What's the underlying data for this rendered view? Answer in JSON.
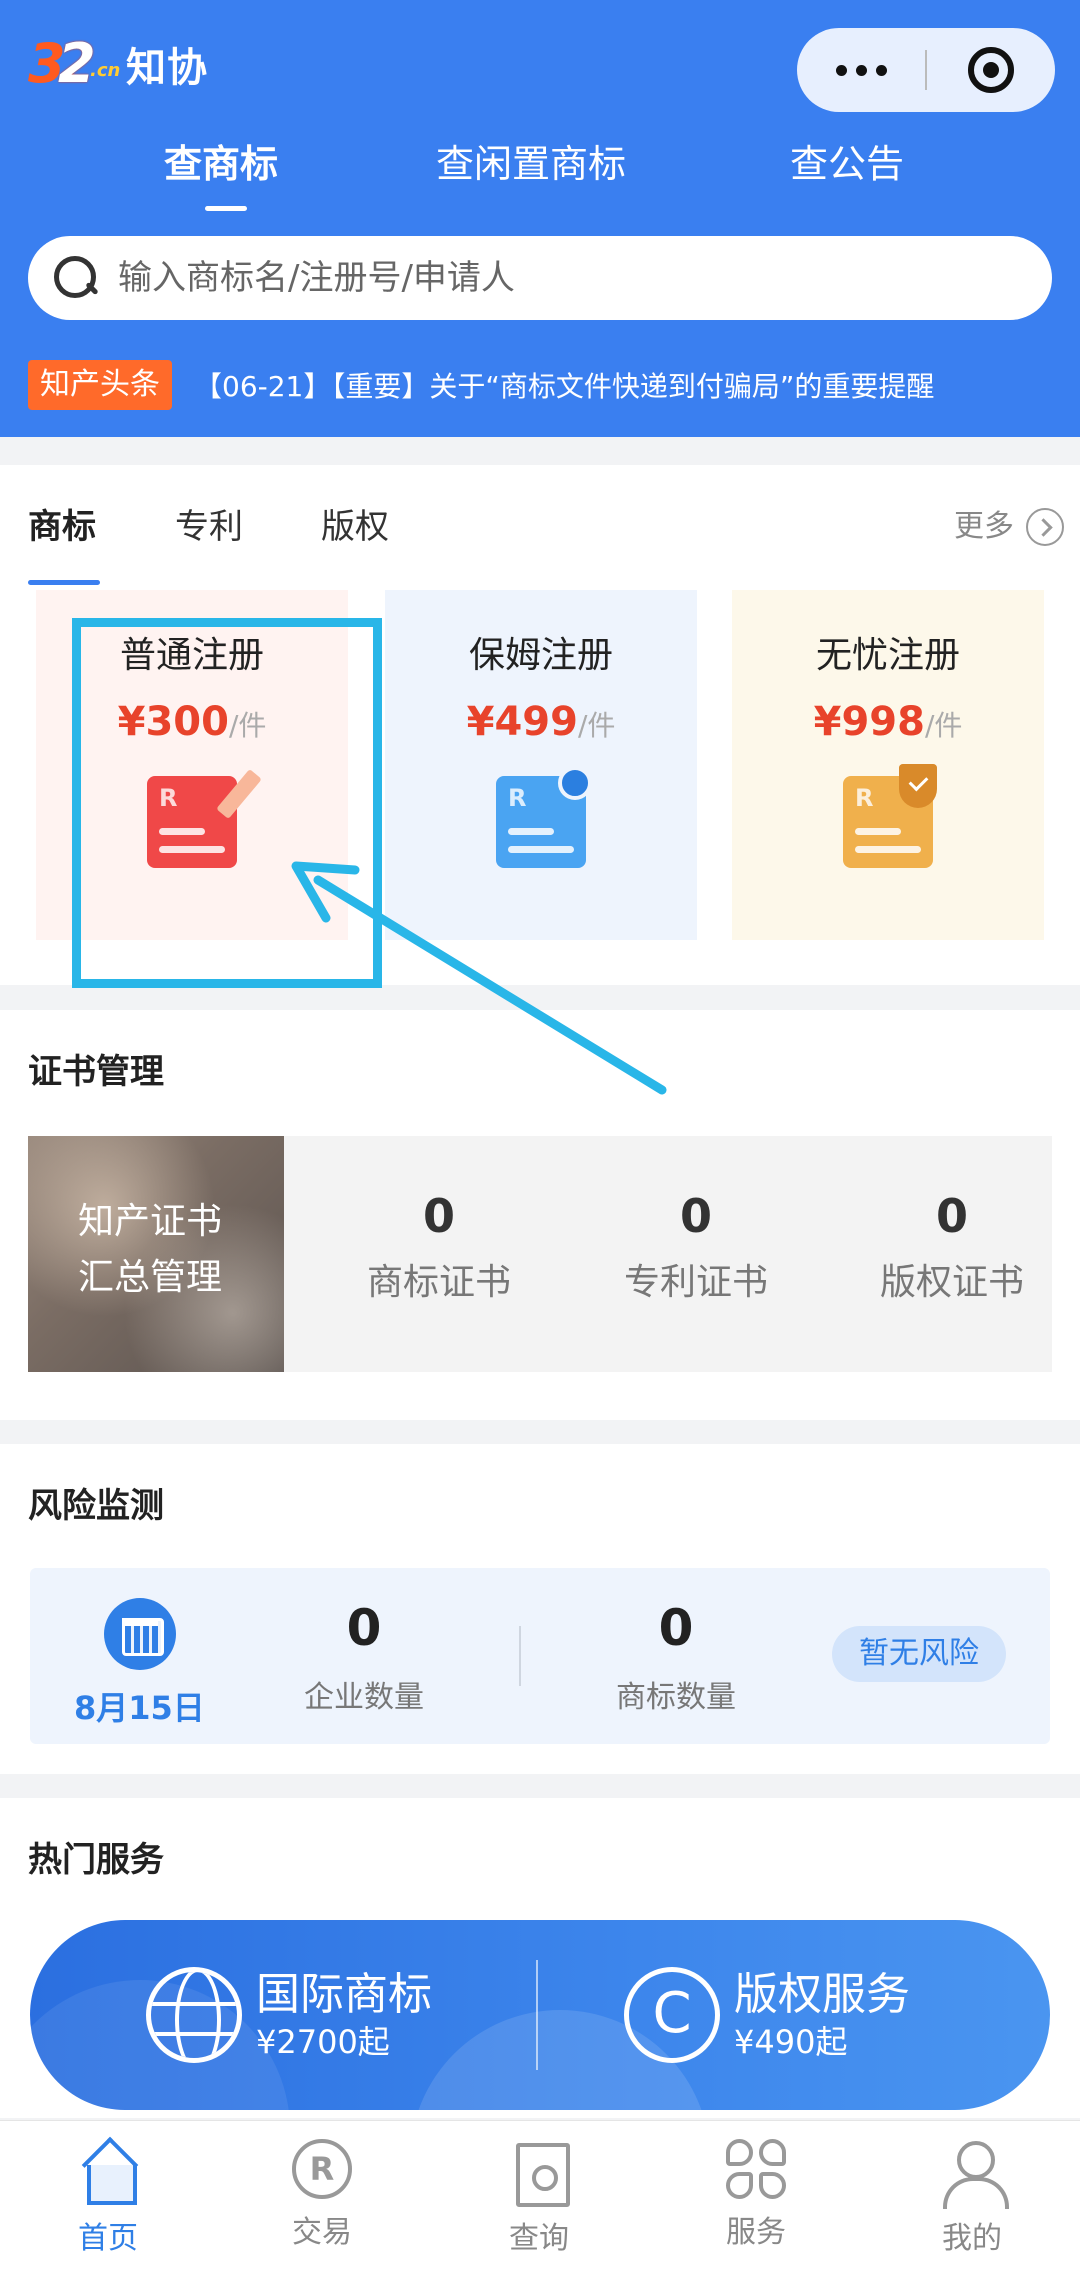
{
  "header": {
    "logo_number": "32",
    "logo_suffix": ".cn",
    "logo_text": "知协",
    "tabs": [
      {
        "label": "查商标",
        "active": true
      },
      {
        "label": "查闲置商标",
        "active": false
      },
      {
        "label": "查公告",
        "active": false
      }
    ],
    "search": {
      "placeholder": "输入商标名/注册号/申请人"
    },
    "news": {
      "tag": "知产头条",
      "text": "【06-21】【重要】关于“商标文件快递到付骗局”的重要提醒"
    }
  },
  "trademark_section": {
    "tabs": [
      "商标",
      "专利",
      "版权"
    ],
    "more_label": "更多",
    "products": [
      {
        "name": "普通注册",
        "price": "¥300",
        "unit": "/件"
      },
      {
        "name": "保姆注册",
        "price": "¥499",
        "unit": "/件"
      },
      {
        "name": "无忧注册",
        "price": "¥998",
        "unit": "/件"
      }
    ]
  },
  "certificate_section": {
    "title": "证书管理",
    "photo_caption_line1": "知产证书",
    "photo_caption_line2": "汇总管理",
    "stats": [
      {
        "value": "0",
        "label": "商标证书"
      },
      {
        "value": "0",
        "label": "专利证书"
      },
      {
        "value": "0",
        "label": "版权证书"
      }
    ]
  },
  "risk_section": {
    "title": "风险监测",
    "date": "8月15日",
    "stats": [
      {
        "value": "0",
        "label": "企业数量"
      },
      {
        "value": "0",
        "label": "商标数量"
      }
    ],
    "badge": "暂无风险"
  },
  "hot_section": {
    "title": "热门服务",
    "items": [
      {
        "title": "国际商标",
        "price": "¥2700起"
      },
      {
        "title": "版权服务",
        "price": "¥490起"
      }
    ]
  },
  "bottom_nav": [
    {
      "label": "首页",
      "active": true
    },
    {
      "label": "交易",
      "active": false
    },
    {
      "label": "查询",
      "active": false
    },
    {
      "label": "服务",
      "active": false
    },
    {
      "label": "我的",
      "active": false
    }
  ],
  "colors": {
    "brand_blue": "#3a7ff0",
    "price_red": "#e8432b",
    "news_tag_orange": "#ff6a2a",
    "highlight_cyan": "#29b6e8"
  }
}
